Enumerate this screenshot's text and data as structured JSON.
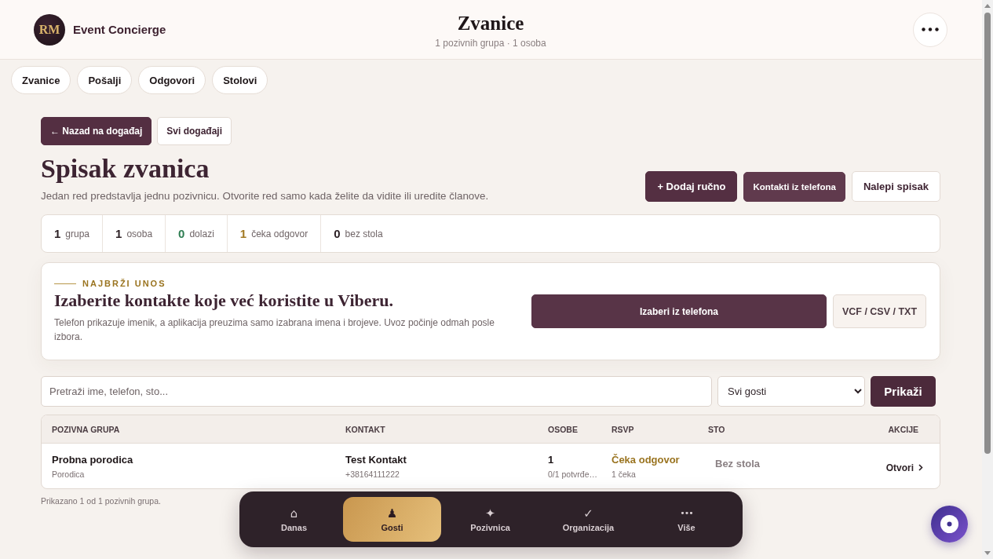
{
  "header": {
    "logo": "RM",
    "brand": "Event Concierge",
    "title": "Zvanice",
    "subtitle": "1 pozivnih grupa · 1 osoba"
  },
  "tabs": [
    {
      "label": "Zvanice"
    },
    {
      "label": "Pošalji"
    },
    {
      "label": "Odgovori"
    },
    {
      "label": "Stolovi"
    }
  ],
  "back_actions": [
    {
      "label": "← Nazad na događaj",
      "kind": "primary"
    },
    {
      "label": "Svi događaji",
      "kind": "secondary"
    }
  ],
  "page": {
    "title": "Spisak zvanica",
    "description": "Jedan red predstavlja jednu pozivnicu. Otvorite red samo kada želite da vidite ili uredite članove."
  },
  "actions": [
    {
      "label": "+ Dodaj ručno",
      "kind": "primary"
    },
    {
      "label": "Kontakti iz telefona",
      "kind": "accent"
    },
    {
      "label": "Nalepi spisak",
      "kind": "secondary"
    }
  ],
  "stats": [
    {
      "value": "1",
      "label": "grupa",
      "color": "#2b1f24"
    },
    {
      "value": "1",
      "label": "osoba",
      "color": "#2b1f24"
    },
    {
      "value": "0",
      "label": "dolazi",
      "color": "#2e7d52"
    },
    {
      "value": "1",
      "label": "čeka odgovor",
      "color": "#a27a24"
    },
    {
      "value": "0",
      "label": "bez stola",
      "color": "#2b1f24"
    }
  ],
  "quick_import": {
    "eyebrow": "NAJBRŽI UNOS",
    "title": "Izaberite kontakte koje već koristite u Viberu.",
    "description": "Telefon prikazuje imenik, a aplikacija preuzima samo izabrana imena i brojeve. Uvoz počinje odmah posle izbora.",
    "buttons": [
      {
        "label": "Izaberi iz telefona",
        "kind": "primary"
      },
      {
        "label": "VCF / CSV / TXT",
        "kind": "secondary"
      }
    ]
  },
  "filter": {
    "search": {
      "placeholder": "Pretraži ime, telefon, sto..."
    },
    "select": {
      "value": "Svi gosti"
    },
    "submit": "Prikaži"
  },
  "table": {
    "columns": [
      "POZIVNA GRUPA",
      "KONTAKT",
      "OSOBE",
      "RSVP",
      "STO",
      "AKCIJE"
    ],
    "rows": [
      {
        "group": "Probna porodica",
        "group_type": "Porodica",
        "contact": "Test Kontakt",
        "phone": "+38164111222",
        "people": "1",
        "confirmed": "0/1 potvrđe…",
        "rsvp": {
          "label": "Čeka odgovor",
          "color": "#9a7420",
          "detail": "1 čeka"
        },
        "table": "Bez stola",
        "action": "Otvori"
      }
    ]
  },
  "footer_note": "Prikazano 1 od 1 pozivnih grupa.",
  "bottom_nav": [
    {
      "label": "Danas",
      "icon": "⌂",
      "selected": false
    },
    {
      "label": "Gosti",
      "icon": "♟",
      "selected": true
    },
    {
      "label": "Pozivnica",
      "icon": "✦",
      "selected": false
    },
    {
      "label": "Organizacija",
      "icon": "✓",
      "selected": false
    },
    {
      "label": "Više",
      "icon": "•••",
      "selected": false
    }
  ]
}
